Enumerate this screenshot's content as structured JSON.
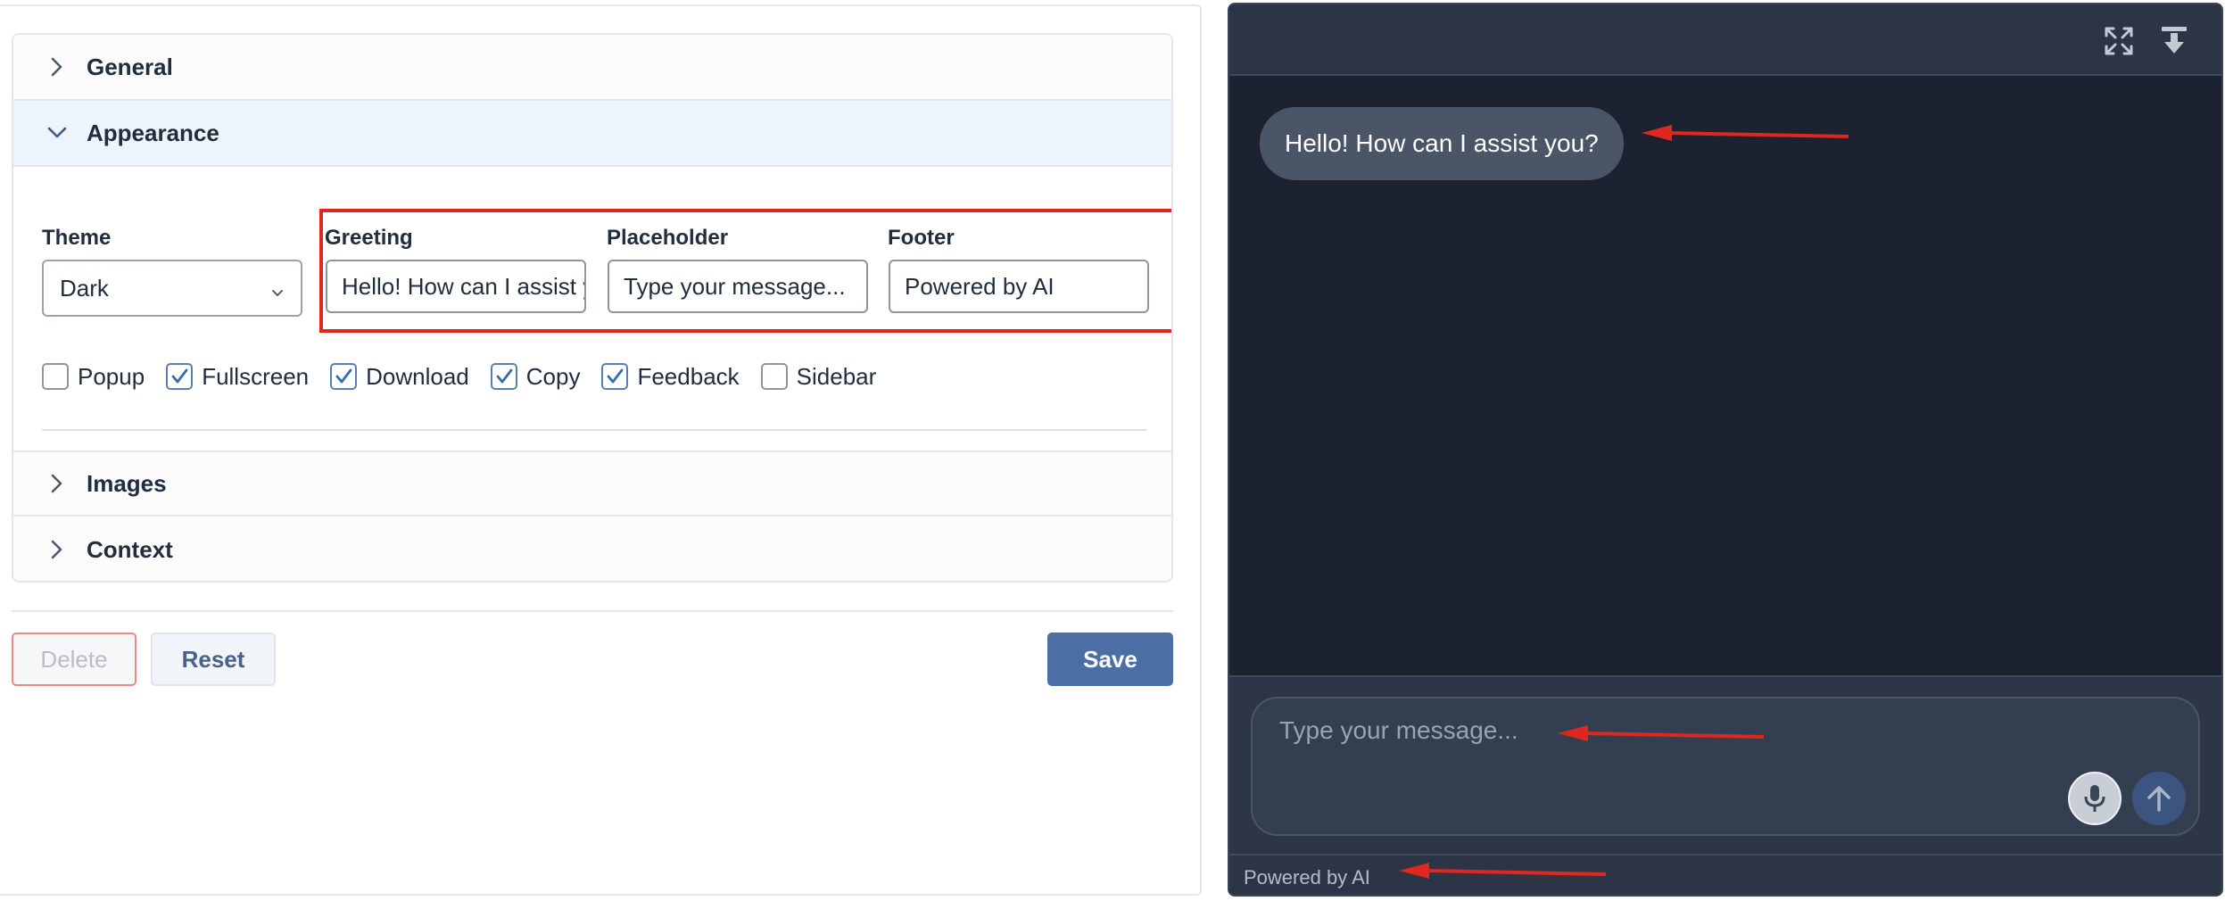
{
  "settings": {
    "sections": {
      "general": "General",
      "appearance": "Appearance",
      "images": "Images",
      "context": "Context"
    },
    "appearance": {
      "theme_label": "Theme",
      "theme_value": "Dark",
      "greeting_label": "Greeting",
      "greeting_value": "Hello! How can I assist you?",
      "placeholder_label": "Placeholder",
      "placeholder_value": "Type your message...",
      "footer_label": "Footer",
      "footer_value": "Powered by AI",
      "options": [
        {
          "label": "Popup",
          "checked": false
        },
        {
          "label": "Fullscreen",
          "checked": true
        },
        {
          "label": "Download",
          "checked": true
        },
        {
          "label": "Copy",
          "checked": true
        },
        {
          "label": "Feedback",
          "checked": true
        },
        {
          "label": "Sidebar",
          "checked": false
        }
      ]
    },
    "buttons": {
      "delete": "Delete",
      "reset": "Reset",
      "save": "Save"
    }
  },
  "chat": {
    "greeting": "Hello! How can I assist you?",
    "placeholder": "Type your message...",
    "footer": "Powered by AI",
    "header_icons": [
      "fullscreen-icon",
      "download-icon"
    ],
    "input_icons": [
      "microphone-icon",
      "send-arrow-icon"
    ]
  },
  "colors": {
    "accent": "#4b6fa5",
    "annotation": "#e0271f",
    "chat_bg": "#1c2230",
    "chat_panel": "#2b3546"
  }
}
